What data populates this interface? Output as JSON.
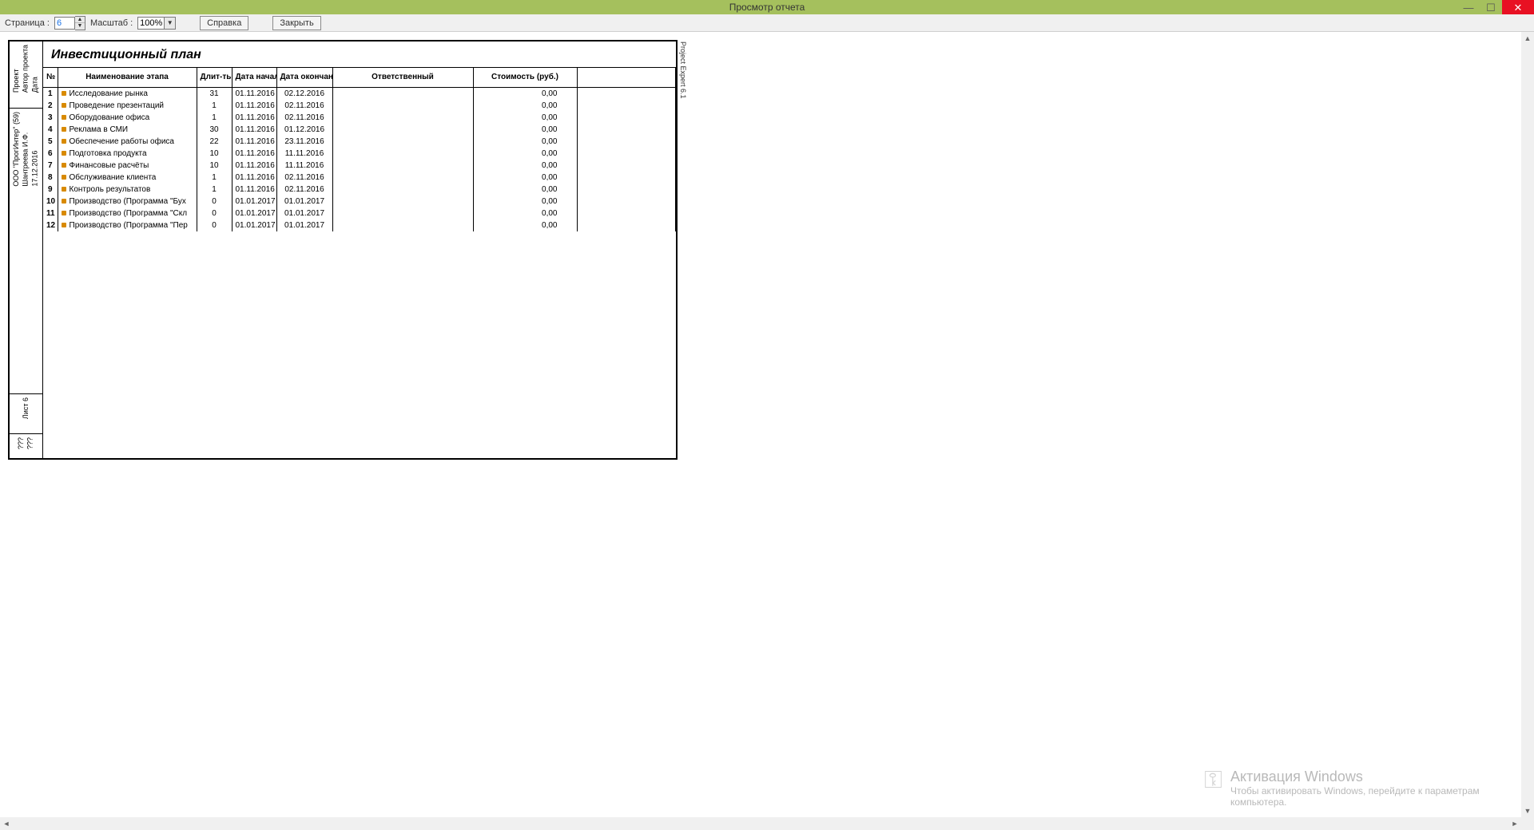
{
  "window": {
    "title": "Просмотр отчета"
  },
  "toolbar": {
    "page_label": "Страница :",
    "page_value": "6",
    "zoom_label": "Масштаб :",
    "zoom_value": "100%",
    "help_label": "Справка",
    "close_label": "Закрыть"
  },
  "report": {
    "vertical_right": "Project Expert 6.1",
    "side": {
      "block1": "Проект\nАвтор проекта\nДата",
      "block2": "ООО \"ПрогИнтер\" (59)\nШантреева И.Ф.\n17.12.2016",
      "block3": "Лист 6",
      "block4": "???\n???"
    },
    "title": "Инвестиционный план",
    "headers": {
      "num": "№",
      "name": "Наименование этапа",
      "duration": "Длит-ть",
      "start": "Дата начала",
      "end": "Дата окончания",
      "responsible": "Ответственный",
      "cost": "Стоимость (руб.)"
    },
    "rows": [
      {
        "n": "1",
        "name": "Исследование рынка",
        "dur": "31",
        "start": "01.11.2016",
        "end": "02.12.2016",
        "resp": "",
        "cost": "0,00"
      },
      {
        "n": "2",
        "name": "Проведение презентаций",
        "dur": "1",
        "start": "01.11.2016",
        "end": "02.11.2016",
        "resp": "",
        "cost": "0,00"
      },
      {
        "n": "3",
        "name": "Оборудование офиса",
        "dur": "1",
        "start": "01.11.2016",
        "end": "02.11.2016",
        "resp": "",
        "cost": "0,00"
      },
      {
        "n": "4",
        "name": "Реклама в СМИ",
        "dur": "30",
        "start": "01.11.2016",
        "end": "01.12.2016",
        "resp": "",
        "cost": "0,00"
      },
      {
        "n": "5",
        "name": "Обеспечение работы офиса",
        "dur": "22",
        "start": "01.11.2016",
        "end": "23.11.2016",
        "resp": "",
        "cost": "0,00"
      },
      {
        "n": "6",
        "name": "Подготовка продукта",
        "dur": "10",
        "start": "01.11.2016",
        "end": "11.11.2016",
        "resp": "",
        "cost": "0,00"
      },
      {
        "n": "7",
        "name": "Финансовые расчёты",
        "dur": "10",
        "start": "01.11.2016",
        "end": "11.11.2016",
        "resp": "",
        "cost": "0,00"
      },
      {
        "n": "8",
        "name": "Обслуживание клиента",
        "dur": "1",
        "start": "01.11.2016",
        "end": "02.11.2016",
        "resp": "",
        "cost": "0,00"
      },
      {
        "n": "9",
        "name": "Контроль результатов",
        "dur": "1",
        "start": "01.11.2016",
        "end": "02.11.2016",
        "resp": "",
        "cost": "0,00"
      },
      {
        "n": "10",
        "name": "Производство (Программа \"Бух",
        "dur": "0",
        "start": "01.01.2017",
        "end": "01.01.2017",
        "resp": "",
        "cost": "0,00"
      },
      {
        "n": "11",
        "name": "Производство (Программа \"Скл",
        "dur": "0",
        "start": "01.01.2017",
        "end": "01.01.2017",
        "resp": "",
        "cost": "0,00"
      },
      {
        "n": "12",
        "name": "Производство (Программа \"Пер",
        "dur": "0",
        "start": "01.01.2017",
        "end": "01.01.2017",
        "resp": "",
        "cost": "0,00"
      }
    ]
  },
  "watermark": {
    "title": "Активация Windows",
    "sub": "Чтобы активировать Windows, перейдите к параметрам компьютера."
  }
}
